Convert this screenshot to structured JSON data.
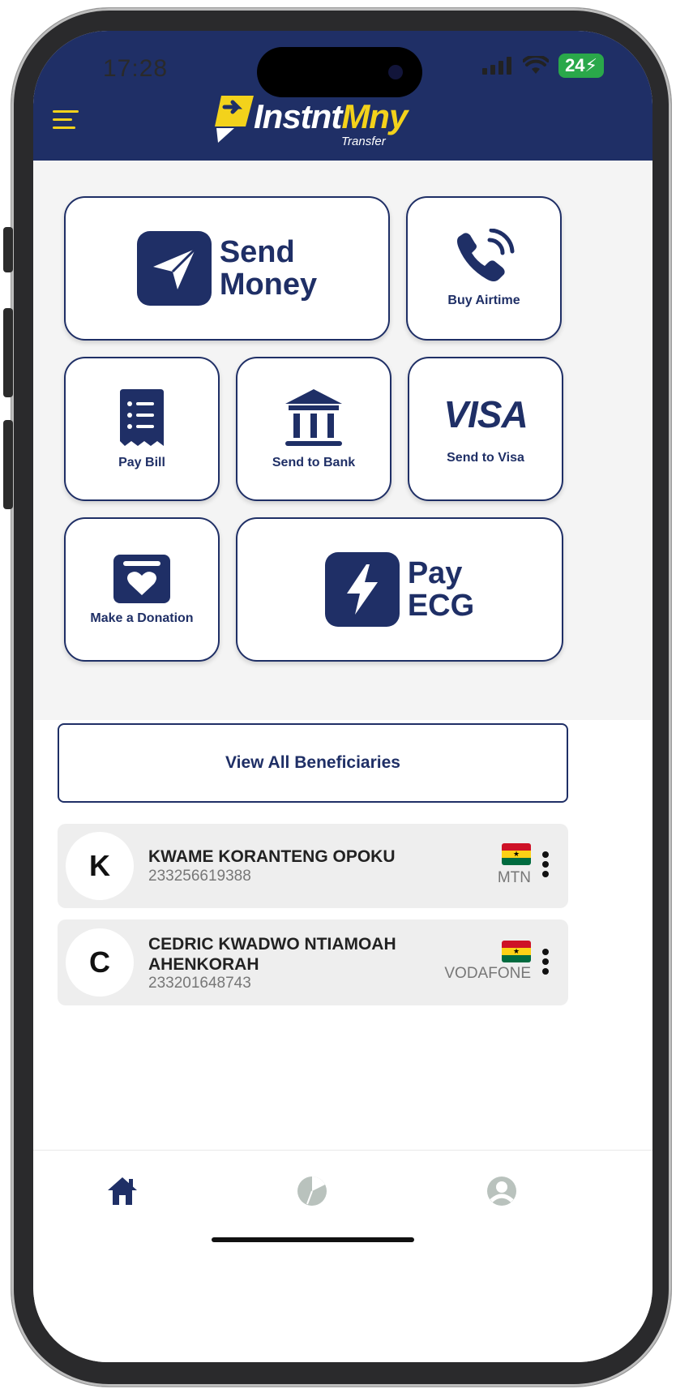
{
  "status_bar": {
    "time": "17:28",
    "battery": "24"
  },
  "header": {
    "logo_main_white": "Instnt",
    "logo_main_yellow": "Mny",
    "logo_sub": "Transfer"
  },
  "services": {
    "send_money": {
      "line1": "Send",
      "line2": "Money"
    },
    "buy_airtime": {
      "label": "Buy Airtime"
    },
    "pay_bill": {
      "label": "Pay Bill"
    },
    "send_to_bank": {
      "label": "Send to Bank"
    },
    "send_to_visa": {
      "logo": "VISA",
      "label": "Send to Visa"
    },
    "make_donation": {
      "label": "Make a Donation"
    },
    "pay_ecg": {
      "line1": "Pay",
      "line2": "ECG"
    }
  },
  "beneficiaries": {
    "view_all_label": "View All Beneficiaries",
    "items": [
      {
        "initial": "K",
        "name": "KWAME KORANTENG OPOKU",
        "phone": "233256619388",
        "network": "MTN"
      },
      {
        "initial": "C",
        "name": "CEDRIC KWADWO NTIAMOAH AHENKORAH",
        "phone": "233201648743",
        "network": "VODAFONE"
      }
    ]
  },
  "colors": {
    "brand_navy": "#1f2f66",
    "brand_yellow": "#f3d21b",
    "muted_gray": "#9e9e9e"
  },
  "bottom_nav": {
    "items": [
      "home-icon",
      "pie-chart-icon",
      "profile-icon"
    ],
    "active": "home-icon"
  }
}
